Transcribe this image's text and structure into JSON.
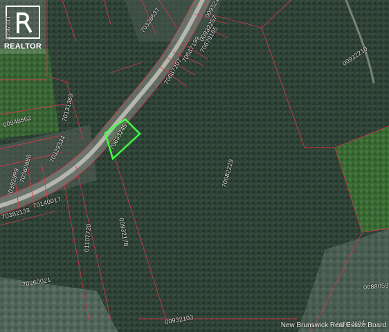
{
  "map": {
    "credit": "New Brunswick Real Estate Board",
    "logo_text": "REALTOR",
    "highlighted_parcel": "70693245",
    "parcel_ids": [
      {
        "id": "7056331",
        "name": "parcel-id-7056331"
      },
      {
        "id": "00932167",
        "name": "parcel-id-00932167"
      },
      {
        "id": "70328637",
        "name": "parcel-id-70328637"
      },
      {
        "id": "00932257",
        "name": "parcel-id-00932257"
      },
      {
        "id": "70679165",
        "name": "parcel-id-70679165"
      },
      {
        "id": "70687199",
        "name": "parcel-id-70687199"
      },
      {
        "id": "70687207",
        "name": "parcel-id-70687207"
      },
      {
        "id": "00932210",
        "name": "parcel-id-00932210"
      },
      {
        "id": "70131369",
        "name": "parcel-id-70131369"
      },
      {
        "id": "00948562",
        "name": "parcel-id-00948562"
      },
      {
        "id": "70693245",
        "name": "parcel-id-70693245"
      },
      {
        "id": "70329334",
        "name": "parcel-id-70329334"
      },
      {
        "id": "70392999",
        "name": "parcel-id-70392999"
      },
      {
        "id": "70360686",
        "name": "parcel-id-70360686"
      },
      {
        "id": "70682229",
        "name": "parcel-id-70682229"
      },
      {
        "id": "70382133",
        "name": "parcel-id-70382133"
      },
      {
        "id": "70140017",
        "name": "parcel-id-70140017"
      },
      {
        "id": "00932178",
        "name": "parcel-id-00932178"
      },
      {
        "id": "01107720",
        "name": "parcel-id-01107720"
      },
      {
        "id": "70260021",
        "name": "parcel-id-70260021"
      },
      {
        "id": "00932103",
        "name": "parcel-id-00932103"
      },
      {
        "id": "00880597",
        "name": "parcel-id-00880597"
      },
      {
        "id": "00932164",
        "name": "parcel-id-00932164"
      }
    ]
  }
}
